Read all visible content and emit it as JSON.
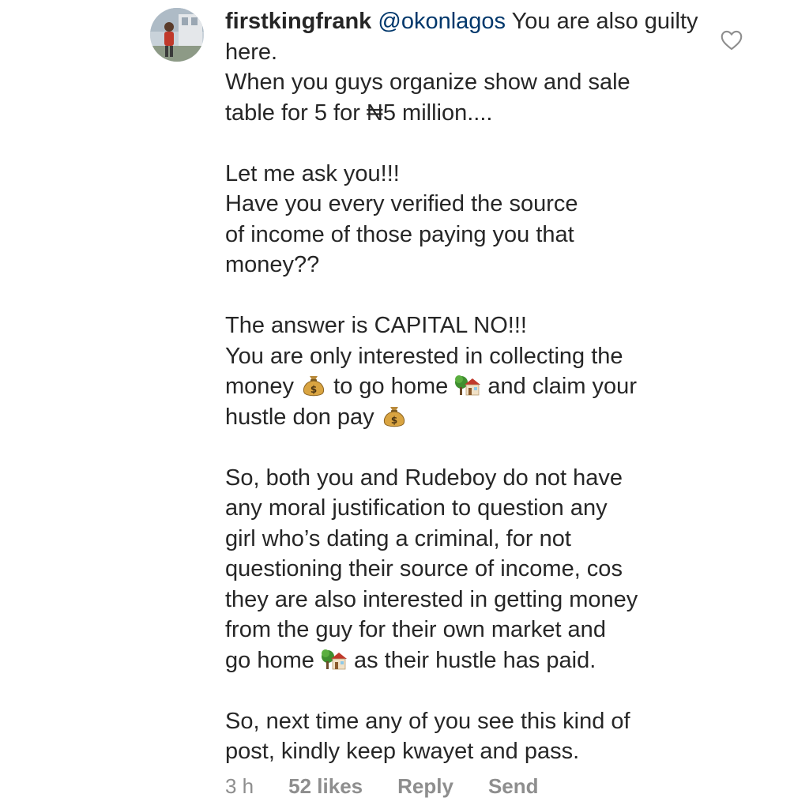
{
  "comment": {
    "username": "firstkingfrank",
    "mention": "@okonlagos",
    "paragraphs": [
      [
        {
          "t": "text",
          "v": " You are also guilty here."
        },
        {
          "t": "br"
        },
        {
          "t": "text",
          "v": "When you guys organize show and sale"
        },
        {
          "t": "br"
        },
        {
          "t": "text",
          "v": "table for 5 for ₦5 million...."
        }
      ],
      [
        {
          "t": "text",
          "v": "Let me ask you!!!"
        },
        {
          "t": "br"
        },
        {
          "t": "text",
          "v": "Have you every verified the source"
        },
        {
          "t": "br"
        },
        {
          "t": "text",
          "v": "of income of those paying you that"
        },
        {
          "t": "br"
        },
        {
          "t": "text",
          "v": "money??"
        }
      ],
      [
        {
          "t": "text",
          "v": "The answer is CAPITAL NO!!!"
        },
        {
          "t": "br"
        },
        {
          "t": "text",
          "v": "You are only interested in collecting the"
        },
        {
          "t": "br"
        },
        {
          "t": "text",
          "v": "money "
        },
        {
          "t": "emoji",
          "v": "money-bag-emoji"
        },
        {
          "t": "text",
          "v": " to go home "
        },
        {
          "t": "emoji",
          "v": "house-emoji"
        },
        {
          "t": "text",
          "v": " and claim your"
        },
        {
          "t": "br"
        },
        {
          "t": "text",
          "v": "hustle don pay "
        },
        {
          "t": "emoji",
          "v": "money-bag-emoji"
        }
      ],
      [
        {
          "t": "text",
          "v": "So, both you and Rudeboy do not have"
        },
        {
          "t": "br"
        },
        {
          "t": "text",
          "v": "any moral justification to question any"
        },
        {
          "t": "br"
        },
        {
          "t": "text",
          "v": "girl who’s dating a criminal, for not"
        },
        {
          "t": "br"
        },
        {
          "t": "text",
          "v": "questioning their source of income, cos"
        },
        {
          "t": "br"
        },
        {
          "t": "text",
          "v": "they are also interested in getting money"
        },
        {
          "t": "br"
        },
        {
          "t": "text",
          "v": "from the guy for their own market and"
        },
        {
          "t": "br"
        },
        {
          "t": "text",
          "v": "go home "
        },
        {
          "t": "emoji",
          "v": "house-emoji"
        },
        {
          "t": "text",
          "v": " as their hustle has paid."
        }
      ],
      [
        {
          "t": "text",
          "v": "So, next time any of you see this kind of"
        },
        {
          "t": "br"
        },
        {
          "t": "text",
          "v": "post, kindly keep kwayet and pass."
        }
      ]
    ]
  },
  "meta": {
    "time": "3 h",
    "likes": "52 likes",
    "reply_label": "Reply",
    "send_label": "Send"
  },
  "icons": {
    "like": "heart-outline-icon",
    "avatar": "user-avatar"
  },
  "colors": {
    "text": "#262626",
    "meta": "#8e8e8e",
    "mention": "#00376b"
  }
}
